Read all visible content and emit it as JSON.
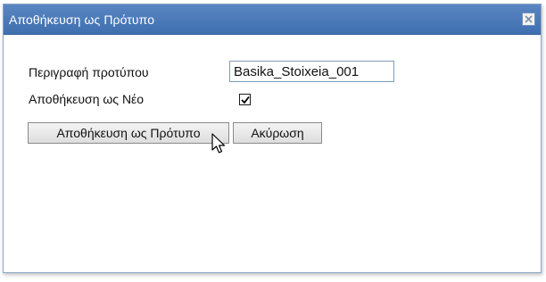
{
  "dialog": {
    "title": "Αποθήκευση ως Πρότυπο",
    "close_icon": "close-icon"
  },
  "form": {
    "description_label": "Περιγραφή προτύπου",
    "description_value": "Basika_Stoixeia_001",
    "save_as_new_label": "Αποθήκευση ως Νέο",
    "save_as_new_checked": true
  },
  "buttons": {
    "save_label": "Αποθήκευση ως Πρότυπο",
    "cancel_label": "Ακύρωση"
  },
  "colors": {
    "titlebar": "#4a7bbd",
    "button_bg": "#e6e6e6"
  }
}
